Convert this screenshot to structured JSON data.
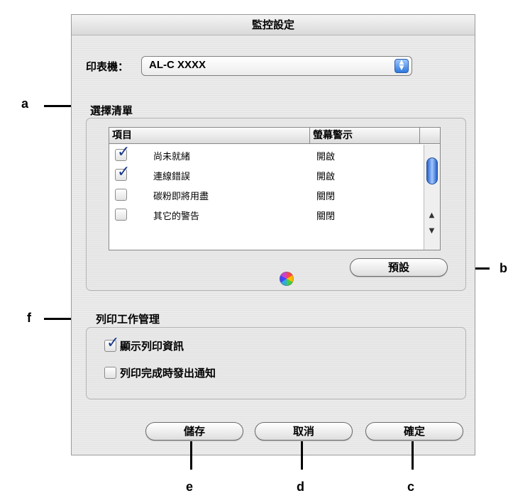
{
  "dialog": {
    "title": "監控設定",
    "printer_label": "印表機：",
    "printer_value": "AL-C XXXX"
  },
  "select_list": {
    "section_title": "選擇清單",
    "columns": [
      "項目",
      "螢幕警示"
    ],
    "rows": [
      {
        "checked": true,
        "name": "尚未就緒",
        "state": "開啟"
      },
      {
        "checked": true,
        "name": "連線錯誤",
        "state": "開啟"
      },
      {
        "checked": false,
        "name": "碳粉即將用盡",
        "state": "關閉"
      },
      {
        "checked": false,
        "name": "其它的警告",
        "state": "關閉"
      }
    ],
    "default_button": "預設"
  },
  "job_management": {
    "section_title": "列印工作管理",
    "options": [
      {
        "checked": true,
        "label": "顯示列印資訊"
      },
      {
        "checked": false,
        "label": "列印完成時發出通知"
      }
    ]
  },
  "buttons": {
    "save": "儲存",
    "cancel": "取消",
    "ok": "確定"
  },
  "annotations": {
    "a": "a",
    "b": "b",
    "c": "c",
    "d": "d",
    "e": "e",
    "f": "f"
  }
}
